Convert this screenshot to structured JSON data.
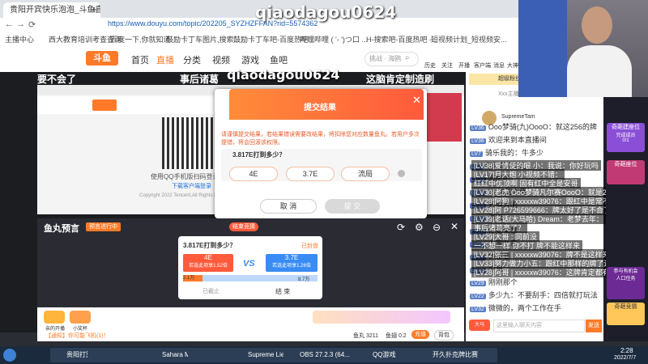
{
  "watermark": "qiaodagou0624",
  "browser": {
    "tab1": "贵阳开宾快乐泡泡_斗鱼直播平台",
    "url": "https://www.douyu.com/topic/202205_SYZHZFFAN?rid=5574362",
    "bookmarks": [
      "主播中心",
      "西大教育培训考查查询",
      "百度一下,你就知道",
      "鼓励卡丁车图片,搜索...",
      "鼓励卡丁车吧-百度热吧...",
      "哔哩哔哩 ( '- ')つ口 ...",
      "H-搜索吧-百度热吧 -...",
      "短视频计划_短视频安..."
    ]
  },
  "douyu": {
    "logo": "斗鱼",
    "nav": [
      "首页",
      "直播",
      "分类",
      "视频",
      "游戏",
      "鱼吧"
    ],
    "search_placeholder": "挑战 · 海鸥",
    "icons": [
      "历史",
      "关注",
      "开播",
      "客户端",
      "消息",
      "大神"
    ]
  },
  "stream": {
    "captions": [
      "要不会了",
      "事后诸葛",
      "这脑肯定制造刷"
    ],
    "qr_hint": "使用QQ手机版扫码登录",
    "qr_hint2": "下载客户端登录",
    "copyright": "Copyright 2022 Tencent,All Rights Reserved",
    "bottom_label": "我在竞猜平台"
  },
  "modal": {
    "title": "提交结果",
    "desc": "请谨慎提交结果，若结果错误需要改结果，将扣除您对应数量鱼丸。若用户多次提错，将会回滚该权限。",
    "question": "3.817E打到多少？",
    "options": [
      "4E",
      "3.7E",
      "流局"
    ],
    "cancel": "取 消",
    "confirm": "提 交"
  },
  "predict": {
    "brand": "鱼丸预言",
    "badge1": "预言进行中",
    "question": "3.817E打到多少？",
    "status": "已封盘",
    "left_title": "4E",
    "left_sub": "若选此项享1.52倍",
    "left_amount": "2.1万",
    "right_title": "3.7E",
    "right_sub": "若选此项享1.26倍",
    "right_amount": "8.7万",
    "vs": "VS",
    "closed": "已截止",
    "end": "结 束",
    "ctrl_btn": "结束竞猜"
  },
  "bottom": {
    "gifts": [
      "亲的开播",
      "小奖杯",
      "",
      "",
      "",
      "",
      "",
      "",
      ""
    ],
    "tip": "【通知】你可能飞机(1)！",
    "fish": "鱼丸 3211",
    "fish2": "鱼翅 0.2",
    "recharge": "充值",
    "bag": "背包"
  },
  "chat": {
    "header": [
      "超级粉丝团",
      "Xxx主播的电影",
      "SupremeTam"
    ],
    "messages": [
      {
        "lv": "LV36",
        "text": "Ooo梦骑(九)OooO：就这256的牌"
      },
      {
        "lv": "LV36",
        "text": "欢迎来到本直播间"
      },
      {
        "lv": "LV7",
        "text": "骑乐我的：牛多少"
      },
      {
        "lv": "LV7",
        "text": "红红的可以了"
      },
      {
        "lv": "LV36",
        "text": "哦吼中"
      },
      {
        "lv": "LV26",
        "text": "LV36的大佬"
      },
      {
        "lv": "LV19",
        "text": "开放大刷"
      },
      {
        "lv": "LV23",
        "text": "清幽"
      },
      {
        "lv": "LV26",
        "text": "你要留意"
      },
      {
        "lv": "LV29",
        "text": "人家会拿"
      },
      {
        "lv": "LV27",
        "text": "你不要"
      },
      {
        "lv": "LV28",
        "text": "少来"
      },
      {
        "lv": "LV29",
        "text": "刚刚那个"
      },
      {
        "lv": "LV22",
        "text": "多少九：不要刮手：四倍就打玩法"
      },
      {
        "lv": "LV32",
        "text": "微微的，两个工作在手"
      }
    ],
    "overlay": [
      "[LV38]爱情使的眼 小：我说：你好玩吗",
      "[LV17]月大炮 小视频不错：",
      "红红中优顶啊 固有红中全是安哥",
      "[LV30]老虎 Ooo梦骑凡尔赛OooO：就是256的牌",
      "[LV29]阿狗 | xxxxxw39076：跟红中是常不",
      "[LV28]阿 P726599666：牌太好了是不合了",
      "[LV39]老话(大马哈) Dream：老梦去年：",
      "事后诸葛亮了？",
      "[LV29]大哥 : 同前没",
      "一不想一样 你不打 牌不能这样来",
      "[LV32]张三 | xxxxxw39076：牌不是这样来",
      "[LV33]努力做力小五：跟红中那样的牌了还是一条龙",
      "[LV28]阿哥 | xxxxxw39076：这牌肯定都有"
    ],
    "input_placeholder": "这里输入聊天内容",
    "send": "发送",
    "sidebar_labels": [
      "奇葩建座位",
      "完成成员",
      "0/1",
      "奇葩座位",
      "参与有机会",
      "人口任务",
      "奇葩竞猜"
    ]
  },
  "taskbar": {
    "items": [
      "贵阳打算快乐泡泡...",
      "",
      "",
      "Sahara Mam...",
      "",
      "Supreme Lien...",
      "OBS 27.2.3 (64...",
      "QQ游戏",
      "开久扑克牌比赛"
    ],
    "time": "2:28",
    "date": "2022/7/7"
  },
  "colors": {
    "douyu_orange": "#ff7a28",
    "modal_header": "#ff6f3a",
    "vs_red": "#ff5a3c",
    "vs_blue": "#3a8cf5"
  }
}
